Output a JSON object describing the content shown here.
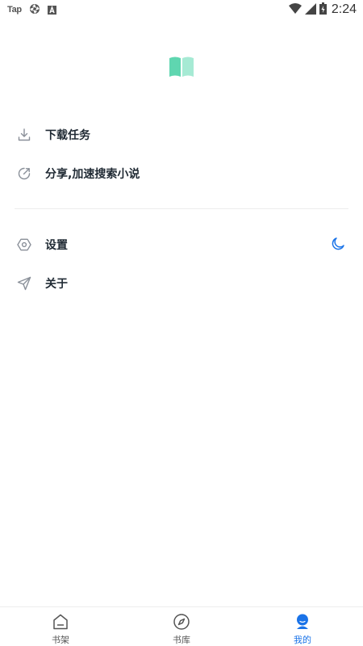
{
  "status_bar": {
    "app_label": "Tap",
    "time": "2:24",
    "icons": [
      "aperture-icon",
      "a-box-icon",
      "wifi-icon",
      "signal-icon",
      "battery-icon"
    ]
  },
  "logo": {
    "icon": "book-icon",
    "color": "#5fd6b0"
  },
  "menu": {
    "download_tasks": "下载任务",
    "share": "分享,加速搜索小说",
    "settings": "设置",
    "about": "关于"
  },
  "night_mode_icon": "moon-icon",
  "colors": {
    "accent": "#1a73e8",
    "icon_gray": "#8a9099",
    "text_dark": "#1f2933",
    "logo_green": "#5fd6b0"
  },
  "bottom_nav": {
    "active": "mine",
    "items": [
      {
        "label": "书架",
        "icon": "home-icon"
      },
      {
        "label": "书库",
        "icon": "compass-icon"
      },
      {
        "label": "我的",
        "icon": "user-icon"
      }
    ]
  }
}
